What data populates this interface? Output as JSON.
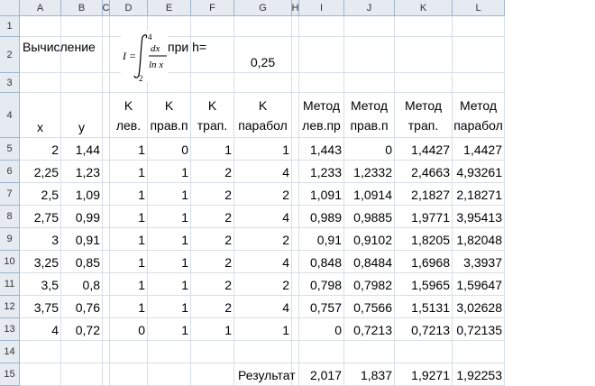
{
  "columns": [
    "A",
    "B",
    "C",
    "D",
    "E",
    "F",
    "G",
    "H",
    "I",
    "J",
    "K",
    "L"
  ],
  "rows": [
    "1",
    "2",
    "3",
    "4",
    "5",
    "6",
    "7",
    "8",
    "9",
    "10",
    "11",
    "12",
    "13",
    "14",
    "15"
  ],
  "title": {
    "label": "Вычисление",
    "formula": {
      "lhs": "I =",
      "lower": "2",
      "upper": "4",
      "numer": "dx",
      "denom": "ln x"
    },
    "h_label": "при h=",
    "h_value": "0,25"
  },
  "headers": {
    "x": "x",
    "y": "y",
    "k_lev": [
      "K",
      "лев."
    ],
    "k_prav": [
      "K",
      "прав.п"
    ],
    "k_trap": [
      "K",
      "трап."
    ],
    "k_parab": [
      "K",
      "парабол"
    ],
    "m_lev": [
      "Метод",
      "лев.пр"
    ],
    "m_prav": [
      "Метод",
      "прав.п"
    ],
    "m_trap": [
      "Метод",
      "трап."
    ],
    "m_parab": [
      "Метод",
      "парабол"
    ]
  },
  "table": [
    [
      "2",
      "1,44",
      "1",
      "0",
      "1",
      "1",
      "1,443",
      "0",
      "1,4427",
      "1,4427"
    ],
    [
      "2,25",
      "1,23",
      "1",
      "1",
      "2",
      "4",
      "1,233",
      "1,2332",
      "2,4663",
      "4,93261"
    ],
    [
      "2,5",
      "1,09",
      "1",
      "1",
      "2",
      "2",
      "1,091",
      "1,0914",
      "2,1827",
      "2,18271"
    ],
    [
      "2,75",
      "0,99",
      "1",
      "1",
      "2",
      "4",
      "0,989",
      "0,9885",
      "1,9771",
      "3,95413"
    ],
    [
      "3",
      "0,91",
      "1",
      "1",
      "2",
      "2",
      "0,91",
      "0,9102",
      "1,8205",
      "1,82048"
    ],
    [
      "3,25",
      "0,85",
      "1",
      "1",
      "2",
      "4",
      "0,848",
      "0,8484",
      "1,6968",
      "3,3937"
    ],
    [
      "3,5",
      "0,8",
      "1",
      "1",
      "2",
      "2",
      "0,798",
      "0,7982",
      "1,5965",
      "1,59647"
    ],
    [
      "3,75",
      "0,76",
      "1",
      "1",
      "2",
      "4",
      "0,757",
      "0,7566",
      "1,5131",
      "3,02628"
    ],
    [
      "4",
      "0,72",
      "0",
      "1",
      "1",
      "1",
      "0",
      "0,7213",
      "0,7213",
      "0,72135"
    ]
  ],
  "result": {
    "label": "Результат",
    "values": [
      "2,017",
      "1,837",
      "1,9271",
      "1,92253"
    ]
  },
  "colors": {
    "header_bg": "#e6eaf1",
    "header_border": "#9eb6ce",
    "grid": "#d9dee6"
  }
}
